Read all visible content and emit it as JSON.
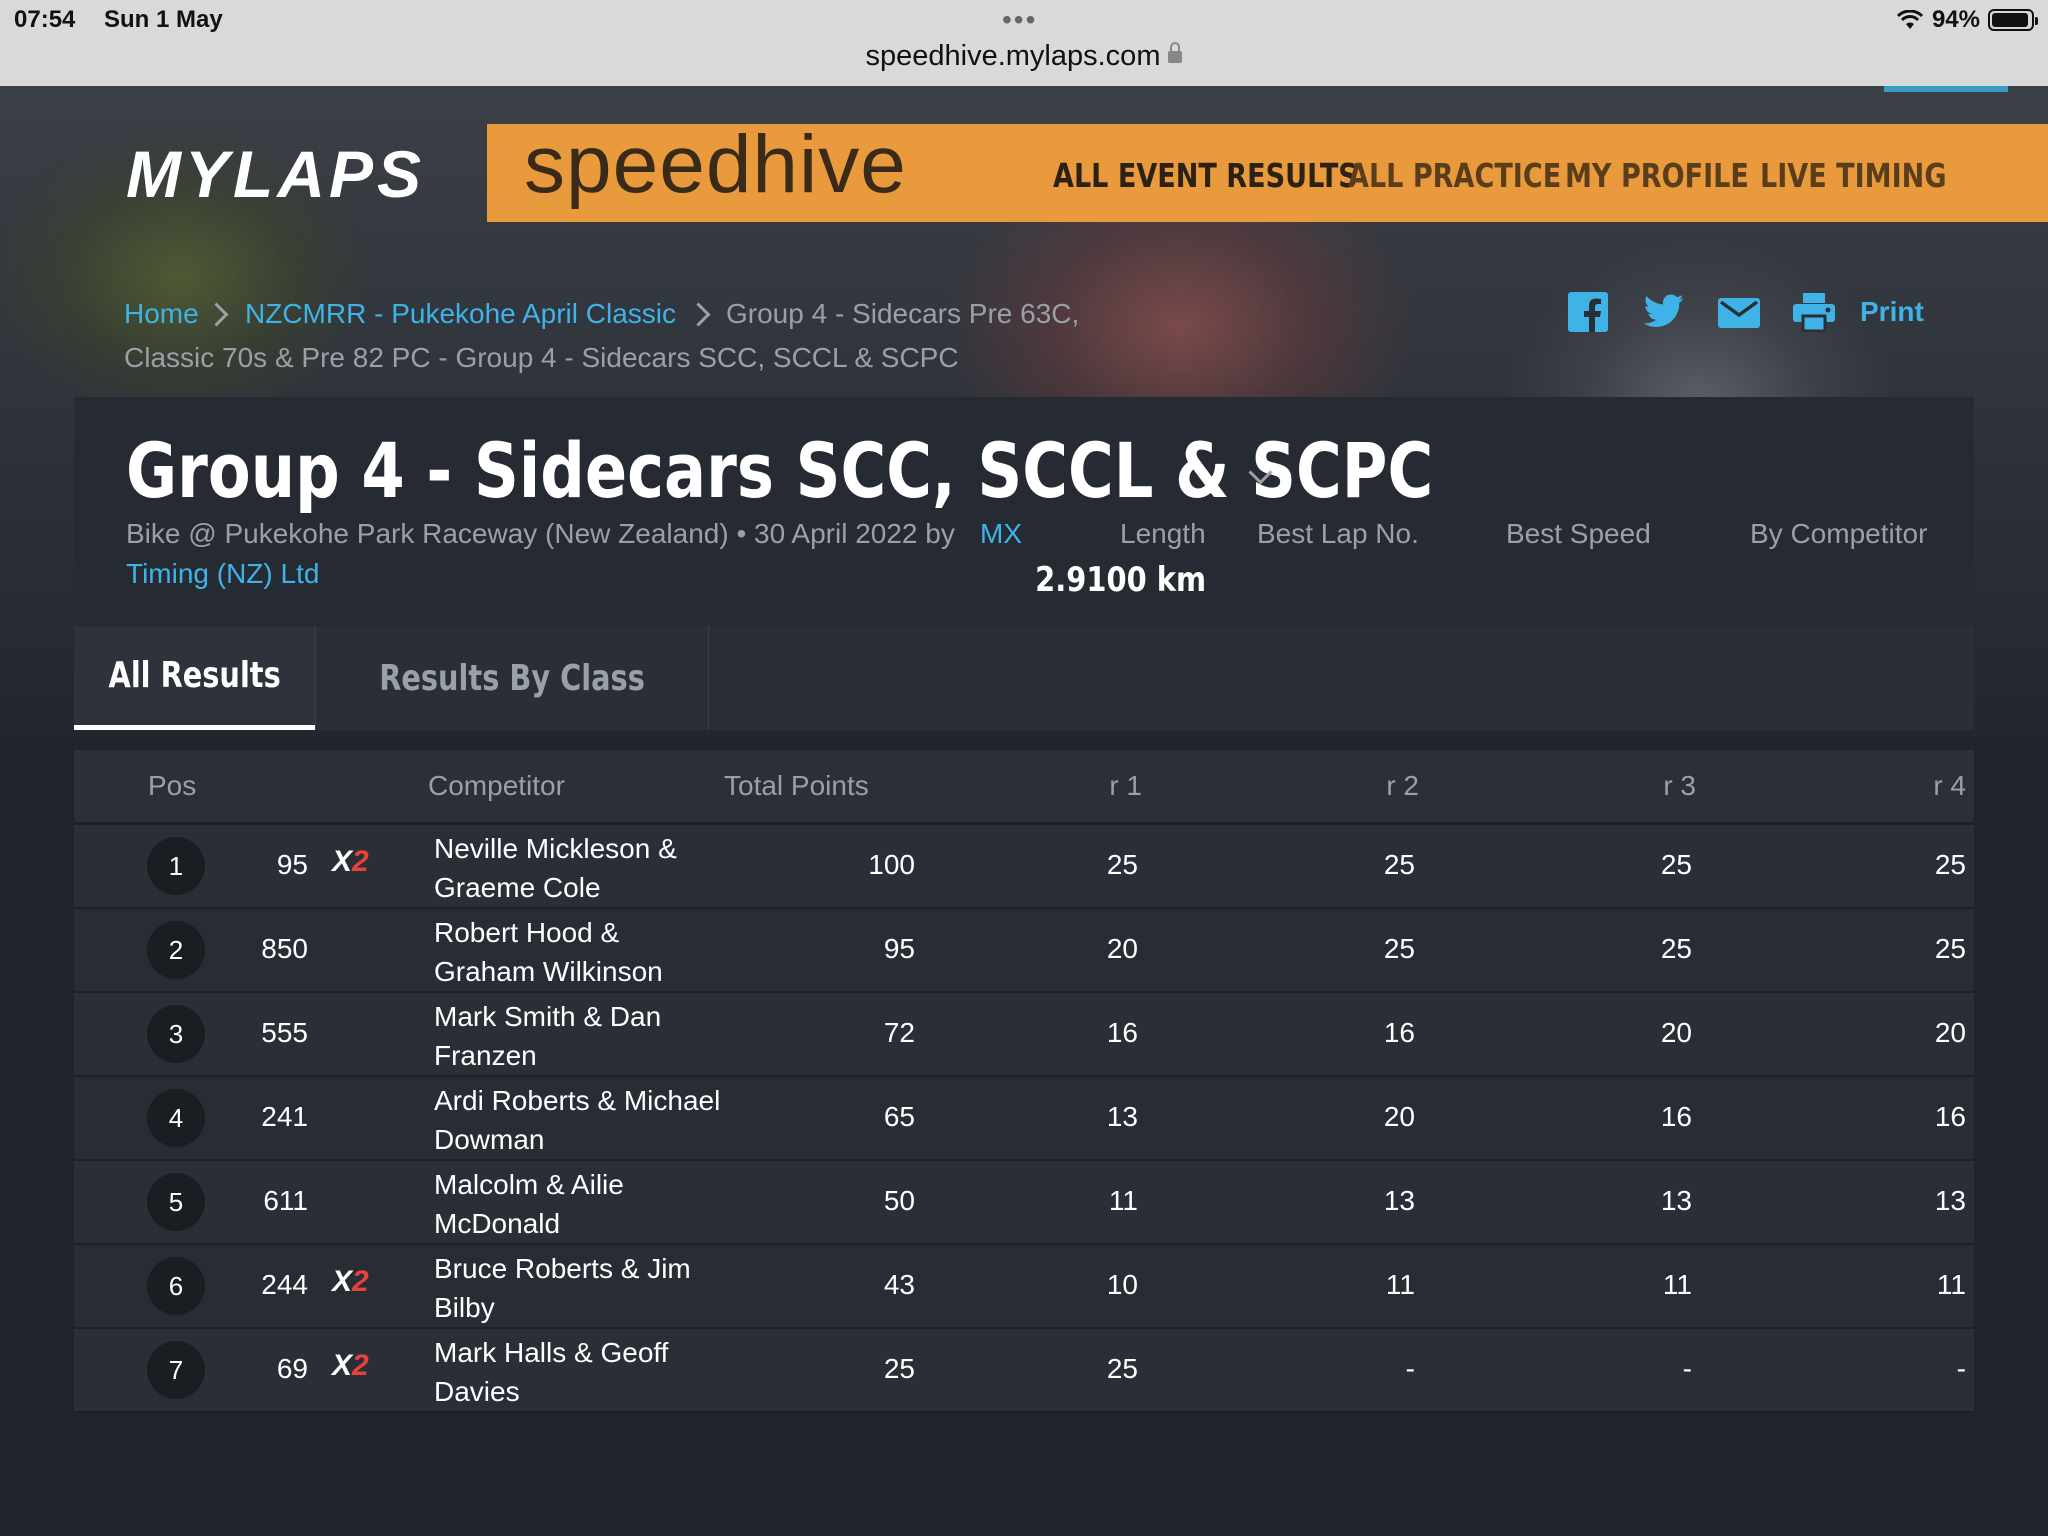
{
  "status_bar": {
    "time": "07:54",
    "date": "Sun 1 May",
    "dots": "•••",
    "url": "speedhive.mylaps.com",
    "battery": "94%",
    "battery_level": 0.94
  },
  "header": {
    "logo": "MYLAPS",
    "brand": "speedhive",
    "nav": [
      "ALL EVENT RESULTS",
      "ALL PRACTICE",
      "MY PROFILE",
      "LIVE TIMING"
    ],
    "brand_color": "#e99a3c",
    "link_color": "#3fb3e6"
  },
  "breadcrumb": {
    "home": "Home",
    "event": "NZCMRR - Pukekohe April Classic",
    "session_line1": "Group 4 - Sidecars Pre 63C,",
    "session_line2": "Classic 70s & Pre 82 PC - Group 4 - Sidecars SCC, SCCL & SCPC"
  },
  "share": {
    "icons": [
      "facebook-icon",
      "twitter-icon",
      "mail-icon",
      "print-icon"
    ],
    "print_label": "Print"
  },
  "event": {
    "title": "Group 4 - Sidecars SCC, SCCL & SCPC",
    "meta_line1": "Bike @ Pukekohe Park Raceway (New Zealand) • 30 April 2022 by",
    "organizer_part1": "MX",
    "organizer_part2": "Timing (NZ) Ltd",
    "length_label": "Length",
    "length_value": "2.9100 km",
    "best_lap_label": "Best Lap No.",
    "best_speed_label": "Best Speed",
    "by_competitor_label": "By Competitor"
  },
  "tabs": [
    "All Results",
    "Results By Class"
  ],
  "results": {
    "headers": {
      "pos": "Pos",
      "competitor": "Competitor",
      "total": "Total Points",
      "r1": "r 1",
      "r2": "r 2",
      "r3": "r 3",
      "r4": "r 4"
    },
    "rows": [
      {
        "pos": "1",
        "number": "95",
        "x2": true,
        "competitor": "Neville Mickleson & Graeme Cole",
        "total": "100",
        "r1": "25",
        "r2": "25",
        "r3": "25",
        "r4": "25"
      },
      {
        "pos": "2",
        "number": "850",
        "x2": false,
        "competitor": "Robert Hood & Graham Wilkinson",
        "total": "95",
        "r1": "20",
        "r2": "25",
        "r3": "25",
        "r4": "25"
      },
      {
        "pos": "3",
        "number": "555",
        "x2": false,
        "competitor": "Mark Smith & Dan Franzen",
        "total": "72",
        "r1": "16",
        "r2": "16",
        "r3": "20",
        "r4": "20"
      },
      {
        "pos": "4",
        "number": "241",
        "x2": false,
        "competitor": "Ardi Roberts & Michael Dowman",
        "total": "65",
        "r1": "13",
        "r2": "20",
        "r3": "16",
        "r4": "16"
      },
      {
        "pos": "5",
        "number": "611",
        "x2": false,
        "competitor": "Malcolm & Ailie McDonald",
        "total": "50",
        "r1": "11",
        "r2": "13",
        "r3": "13",
        "r4": "13"
      },
      {
        "pos": "6",
        "number": "244",
        "x2": true,
        "competitor": "Bruce Roberts & Jim Bilby",
        "total": "43",
        "r1": "10",
        "r2": "11",
        "r3": "11",
        "r4": "11"
      },
      {
        "pos": "7",
        "number": "69",
        "x2": true,
        "competitor": "Mark Halls & Geoff Davies",
        "total": "25",
        "r1": "25",
        "r2": "-",
        "r3": "-",
        "r4": "-"
      }
    ],
    "x2_text": "X",
    "x2_sup": "2"
  }
}
